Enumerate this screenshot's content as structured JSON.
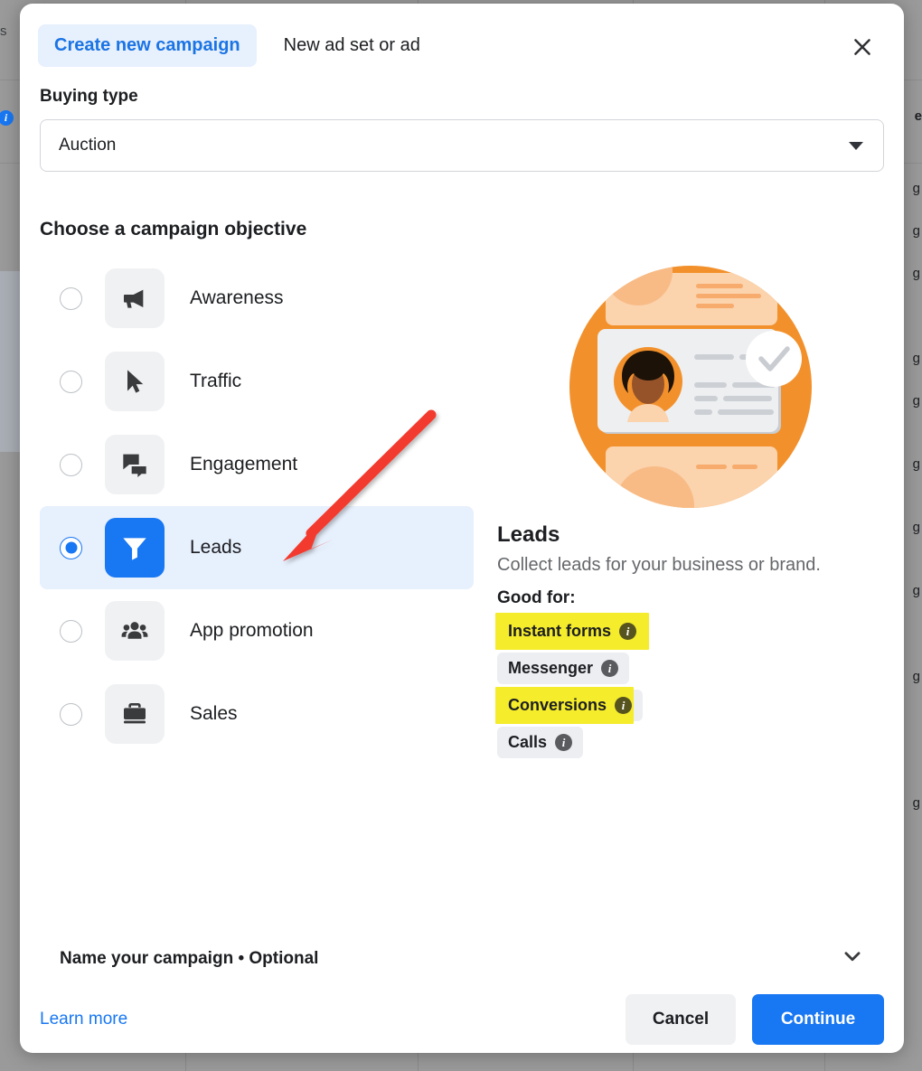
{
  "header": {
    "tab_active": "Create new campaign",
    "tab_inactive": "New ad set or ad",
    "close_icon": "close-icon"
  },
  "buying_type": {
    "label": "Buying type",
    "value": "Auction",
    "caret_icon": "caret-down-icon"
  },
  "objective_section": {
    "title": "Choose a campaign objective",
    "options": [
      {
        "label": "Awareness",
        "icon": "megaphone-icon",
        "selected": false
      },
      {
        "label": "Traffic",
        "icon": "cursor-icon",
        "selected": false
      },
      {
        "label": "Engagement",
        "icon": "chat-bubbles-icon",
        "selected": false
      },
      {
        "label": "Leads",
        "icon": "funnel-icon",
        "selected": true
      },
      {
        "label": "App promotion",
        "icon": "people-icon",
        "selected": false
      },
      {
        "label": "Sales",
        "icon": "briefcase-icon",
        "selected": false
      }
    ]
  },
  "detail_panel": {
    "illustration": "leads-contact-card-illustration",
    "title": "Leads",
    "description": "Collect leads for your business or brand.",
    "good_for_label": "Good for:",
    "chips": [
      {
        "label": "Instant forms",
        "highlighted": true,
        "info_icon": "info-icon"
      },
      {
        "label": "Messenger",
        "highlighted": false,
        "info_icon": "info-icon"
      },
      {
        "label": "Conversions",
        "highlighted": true,
        "info_icon": "info-icon"
      },
      {
        "label": "Calls",
        "highlighted": false,
        "info_icon": "info-icon"
      }
    ]
  },
  "name_campaign": {
    "label": "Name your campaign • Optional",
    "chevron_icon": "chevron-down-icon"
  },
  "footer": {
    "learn_more": "Learn more",
    "cancel": "Cancel",
    "continue": "Continue"
  },
  "annotation": {
    "arrow": "red-arrow-pointing-to-leads",
    "color": "#f23a2e"
  },
  "background": {
    "left_text": "s",
    "info_icon": "info-icon",
    "right_texts": [
      "e",
      "g",
      "g",
      "g",
      "g",
      "g",
      "g",
      "g",
      "g",
      "g",
      "g"
    ]
  },
  "colors": {
    "accent_blue": "#1877f2",
    "selected_row_bg": "#e7f0fd",
    "highlight_yellow": "#f5ec2c",
    "chip_gray": "#eceef1",
    "illustration_orange": "#f2912c"
  }
}
